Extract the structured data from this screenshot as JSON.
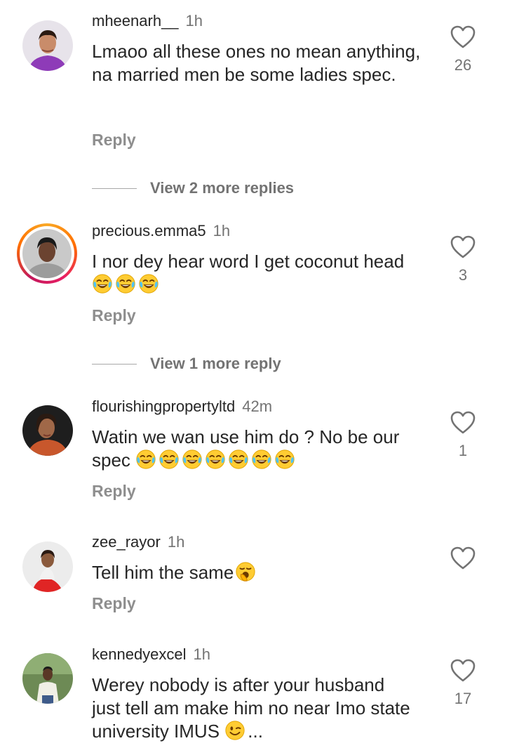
{
  "comments": [
    {
      "username": "mheenarh__",
      "time": "1h",
      "text": "Lmaoo all these ones no mean anything, na married men be some ladies spec.",
      "reply_label": "Reply",
      "likes": "26",
      "view_more": "View 2 more replies",
      "avatar_icon": "avatar-woman-purple-icon"
    },
    {
      "username": "precious.emma5",
      "time": "1h",
      "text": "I nor dey hear word I get coconut head",
      "emojis": [
        "face-with-tears-of-joy",
        "face-with-tears-of-joy",
        "face-with-tears-of-joy"
      ],
      "reply_label": "Reply",
      "likes": "3",
      "view_more": "View 1 more reply",
      "avatar_icon": "avatar-woman-story-ring-icon"
    },
    {
      "username": "flourishingpropertyltd",
      "time": "42m",
      "text": "Watin we wan use him do ? No be our spec",
      "emojis": [
        "face-with-tears-of-joy",
        "face-with-tears-of-joy",
        "face-with-tears-of-joy",
        "face-with-tears-of-joy",
        "face-with-tears-of-joy",
        "face-with-tears-of-joy",
        "face-with-tears-of-joy"
      ],
      "reply_label": "Reply",
      "likes": "1",
      "avatar_icon": "avatar-woman-orange-icon"
    },
    {
      "username": "zee_rayor",
      "time": "1h",
      "text": "Tell him the same",
      "emojis": [
        "yawning-face"
      ],
      "reply_label": "Reply",
      "avatar_icon": "avatar-woman-red-skirt-icon"
    },
    {
      "username": "kennedyexcel",
      "time": "1h",
      "text": "Werey nobody is after your husband just tell am make him no near Imo state university IMUS",
      "emojis": [
        "winking-face"
      ],
      "truncation": "...",
      "likes": "17",
      "avatar_icon": "avatar-man-outdoors-icon"
    }
  ],
  "colors": {
    "text": "#262626",
    "secondary": "#737373",
    "reply": "#8e8e8e",
    "story_ring": "#e91e63"
  }
}
